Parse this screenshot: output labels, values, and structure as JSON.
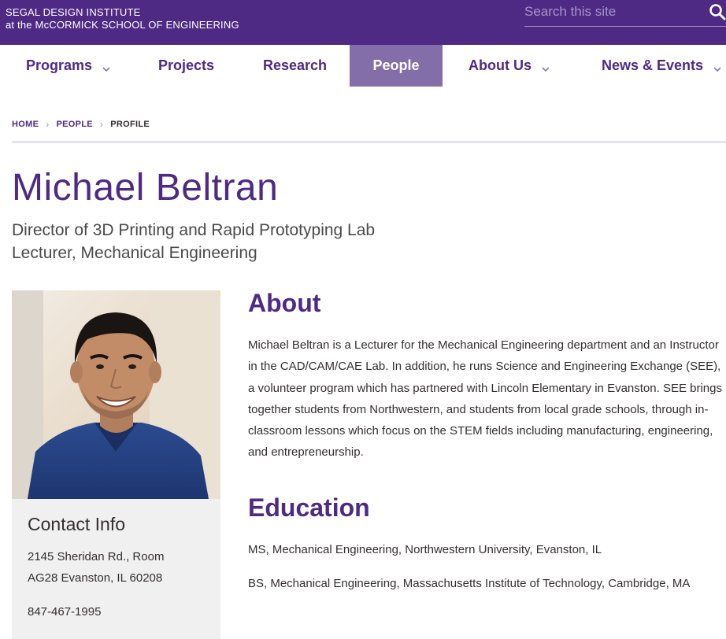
{
  "header": {
    "brand_line1": "SEGAL DESIGN INSTITUTE",
    "brand_line2": "at the McCORMICK SCHOOL OF ENGINEERING",
    "search_placeholder": "Search this site",
    "colors": {
      "primary": "#4e2a84",
      "active_nav": "#836eaa"
    }
  },
  "nav": {
    "items": [
      {
        "label": "Programs",
        "has_dropdown": true
      },
      {
        "label": "Projects",
        "has_dropdown": false
      },
      {
        "label": "Research",
        "has_dropdown": false
      },
      {
        "label": "People",
        "has_dropdown": false,
        "active": true
      },
      {
        "label": "About Us",
        "has_dropdown": true
      },
      {
        "label": "News & Events",
        "has_dropdown": true
      }
    ]
  },
  "breadcrumb": {
    "home": "HOME",
    "people": "PEOPLE",
    "current": "PROFILE"
  },
  "profile": {
    "name": "Michael Beltran",
    "title1": "Director of 3D Printing and Rapid Prototyping Lab",
    "title2": "Lecturer, Mechanical Engineering"
  },
  "contact": {
    "heading": "Contact Info",
    "address_line1": "2145 Sheridan Rd., Room",
    "address_line2": "AG28 Evanston, IL 60208",
    "phone": "847-467-1995"
  },
  "about": {
    "heading": "About",
    "body": "Michael Beltran is a Lecturer for the Mechanical Engineering department and an Instructor in the CAD/CAM/CAE Lab. In addition, he runs Science and Engineering Exchange (SEE), a volunteer program which has partnered with Lincoln Elementary in Evanston. SEE brings together students from Northwestern, and students from local grade schools, through in-classroom lessons which focus on the STEM fields including manufacturing, engineering, and entrepreneurship."
  },
  "education": {
    "heading": "Education",
    "items": [
      "MS, Mechanical Engineering, Northwestern University, Evanston, IL",
      "BS, Mechanical Engineering, Massachusetts Institute of Technology, Cambridge, MA"
    ]
  }
}
